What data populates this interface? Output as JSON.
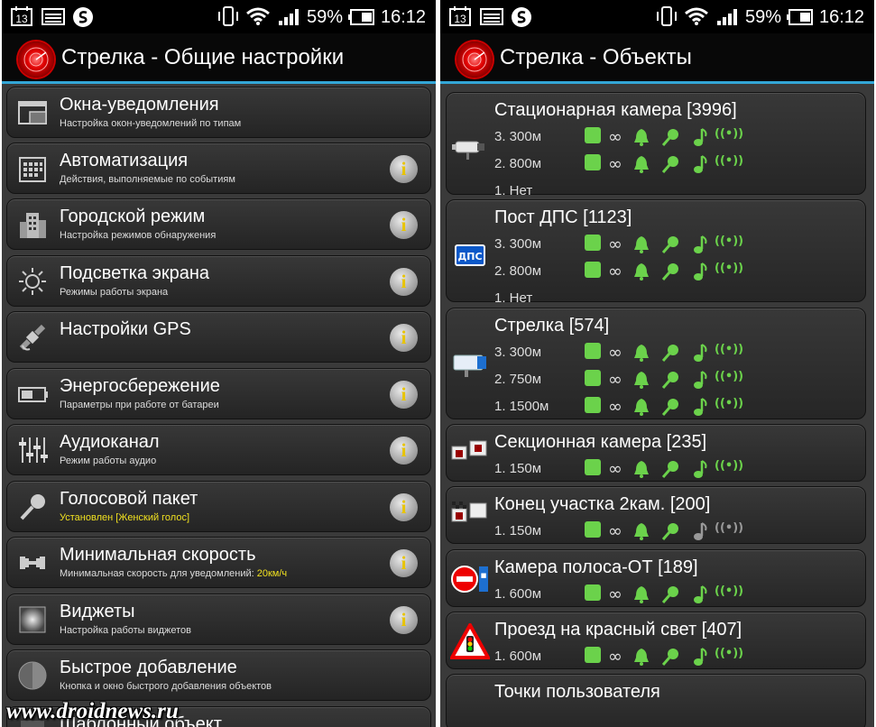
{
  "status_bar": {
    "date_icon": "13",
    "battery_percent": "59%",
    "time": "16:12"
  },
  "left": {
    "title": "Стрелка - Общие настройки",
    "items": [
      {
        "label": "Окна-уведомления",
        "sub": "Настройка окон-уведомлений по типам",
        "icon": "windows-icon",
        "info": false
      },
      {
        "label": "Автоматизация",
        "sub": "Действия, выполняемые по событиям",
        "icon": "calendar-icon",
        "info": true
      },
      {
        "label": "Городской режим",
        "sub": "Настройка режимов обнаружения",
        "icon": "city-icon",
        "info": true
      },
      {
        "label": "Подсветка экрана",
        "sub": "Режимы работы экрана",
        "icon": "sun-icon",
        "info": true
      },
      {
        "label": "Настройки GPS",
        "sub": "",
        "icon": "satellite-icon",
        "info": true
      },
      {
        "label": "Энергосбережение",
        "sub": "Параметры при работе от батареи",
        "icon": "battery-icon",
        "info": true
      },
      {
        "label": "Аудиоканал",
        "sub": "Режим работы аудио",
        "icon": "equalizer-icon",
        "info": true
      },
      {
        "label": "Голосовой пакет",
        "sub_highlight": "Установлен [Женский голос]",
        "icon": "microphone-icon",
        "info": true
      },
      {
        "label": "Минимальная скорость",
        "sub": "Минимальная скорость для уведомлений: ",
        "sub_value": "20км/ч",
        "icon": "dumbbell-icon",
        "info": true
      },
      {
        "label": "Виджеты",
        "sub": "Настройка работы виджетов",
        "icon": "widget-icon",
        "info": true
      },
      {
        "label": "Быстрое добавление",
        "sub": "Кнопка и окно быстрого добавления объектов",
        "icon": "quick-add-icon",
        "info": false
      },
      {
        "label": "Шаблонный объект",
        "sub": "",
        "icon": "template-icon",
        "info": false
      }
    ],
    "info_glyph": "i",
    "watermark": "www.droidnews.ru"
  },
  "right": {
    "title": "Стрелка - Объекты",
    "objects": [
      {
        "name": "Стационарная камера [3996]",
        "icon": "cctv-camera-icon",
        "rows": [
          {
            "dist": "3. 300м",
            "enabled": true
          },
          {
            "dist": "2. 800м",
            "enabled": true
          },
          {
            "dist": "1. Нет",
            "empty": true
          }
        ]
      },
      {
        "name": "Пост ДПС [1123]",
        "icon": "dps-post-icon",
        "icon_text": "ДПС",
        "rows": [
          {
            "dist": "3. 300м",
            "enabled": true
          },
          {
            "dist": "2. 800м",
            "enabled": true
          },
          {
            "dist": "1. Нет",
            "empty": true
          }
        ]
      },
      {
        "name": "Стрелка [574]",
        "icon": "strelka-camera-icon",
        "rows": [
          {
            "dist": "3. 300м",
            "enabled": true
          },
          {
            "dist": "2. 750м",
            "enabled": true
          },
          {
            "dist": "1. 1500м",
            "enabled": true
          }
        ]
      },
      {
        "name": "Секционная камера [235]",
        "icon": "section-camera-icon",
        "rows": [
          {
            "dist": "1. 150м",
            "enabled": true
          }
        ]
      },
      {
        "name": "Конец участка 2кам. [200]",
        "icon": "section-end-icon",
        "rows": [
          {
            "dist": "1. 150м",
            "enabled": false
          }
        ]
      },
      {
        "name": "Камера полоса-ОТ [189]",
        "icon": "bus-lane-icon",
        "rows": [
          {
            "dist": "1. 600м",
            "enabled": true
          }
        ]
      },
      {
        "name": "Проезд на красный свет [407]",
        "icon": "red-light-icon",
        "rows": [
          {
            "dist": "1. 600м",
            "enabled": true
          }
        ]
      },
      {
        "name": "Точки пользователя",
        "icon": "user-points-icon",
        "rows": []
      }
    ],
    "infinity": "∞",
    "radio_glyph": "((•))"
  },
  "colors": {
    "accent_line": "#33a6d6",
    "enabled_green": "#6bd24b",
    "disabled_gray": "#999999",
    "info_yellow": "#e8c400"
  }
}
